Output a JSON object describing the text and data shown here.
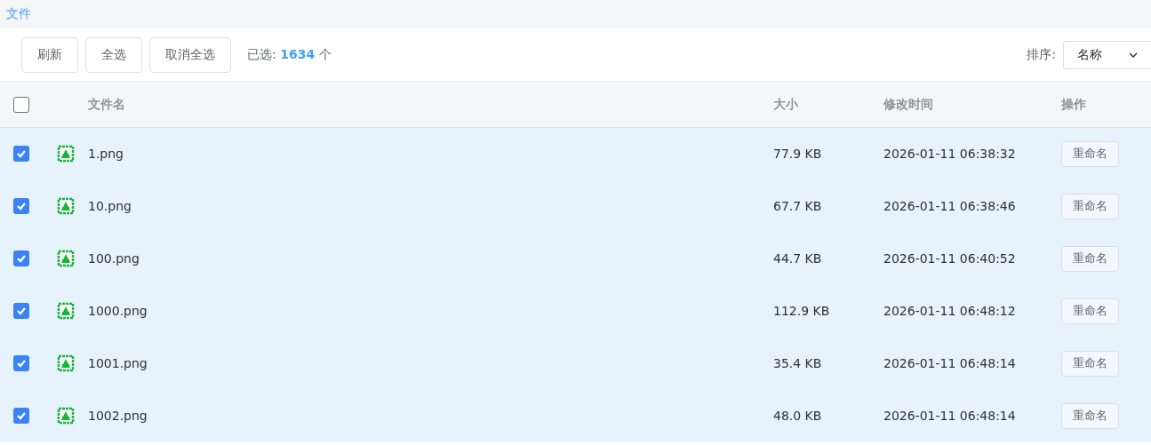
{
  "breadcrumb": {
    "label": "文件"
  },
  "toolbar": {
    "buttons": [
      "刷新",
      "全选",
      "取消全选"
    ],
    "selection_label": "已选:",
    "selection_count": "1634",
    "selection_unit": "个",
    "sort_label": "排序:",
    "sort_value": "名称"
  },
  "table": {
    "select_all_checked": false,
    "columns": [
      "文件名",
      "大小",
      "修改时间",
      "操作"
    ],
    "rows": [
      {
        "checked": true,
        "name": "1.png",
        "size": "77.9 KB",
        "modified": "2026-01-11 06:38:32",
        "action": "重命名"
      },
      {
        "checked": true,
        "name": "10.png",
        "size": "67.7 KB",
        "modified": "2026-01-11 06:38:46",
        "action": "重命名"
      },
      {
        "checked": true,
        "name": "100.png",
        "size": "44.7 KB",
        "modified": "2026-01-11 06:40:52",
        "action": "重命名"
      },
      {
        "checked": true,
        "name": "1000.png",
        "size": "112.9 KB",
        "modified": "2026-01-11 06:48:12",
        "action": "重命名"
      },
      {
        "checked": true,
        "name": "1001.png",
        "size": "35.4 KB",
        "modified": "2026-01-11 06:48:14",
        "action": "重命名"
      },
      {
        "checked": true,
        "name": "1002.png",
        "size": "48.0 KB",
        "modified": "2026-01-11 06:48:14",
        "action": "重命名"
      }
    ]
  }
}
